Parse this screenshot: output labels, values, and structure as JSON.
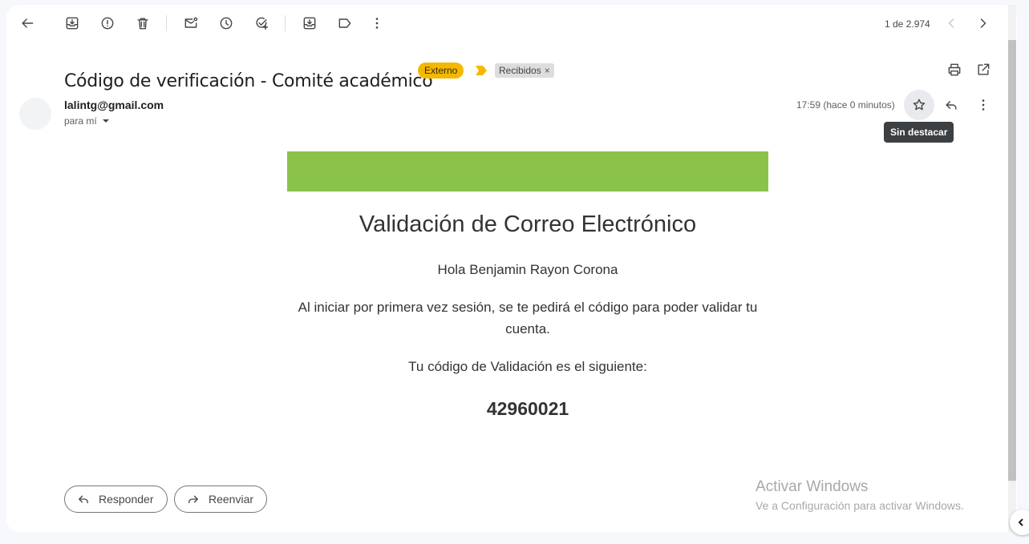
{
  "toolbar": {
    "icons": [
      "back-arrow-icon",
      "archive-icon",
      "report-spam-icon",
      "delete-icon",
      "mark-unread-icon",
      "snooze-icon",
      "add-to-tasks-icon",
      "move-to-icon",
      "label-icon",
      "more-vert-icon"
    ],
    "pager": "1 de 2.974"
  },
  "email": {
    "subject": "Código de verificación - Comité académico",
    "external_label": "Externo",
    "folder_label": "Recibidos",
    "folder_remove": "×",
    "sender": "lalintg@gmail.com",
    "to": "para mí",
    "time": "17:59 (hace 0 minutos)",
    "star_tooltip": "Sin destacar"
  },
  "body": {
    "banner_color": "#8bc34a",
    "title": "Validación de Correo Electrónico",
    "greeting": "Hola Benjamin Rayon Corona",
    "paragraph1": "Al iniciar por primera vez sesión, se te pedirá el código para poder validar tu cuenta.",
    "paragraph2": "Tu código de Validación es el siguiente:",
    "code": "42960021"
  },
  "actions": {
    "reply": "Responder",
    "forward": "Reenviar"
  },
  "watermark": {
    "line1": "Activar Windows",
    "line2": "Ve a Configuración para activar Windows."
  }
}
